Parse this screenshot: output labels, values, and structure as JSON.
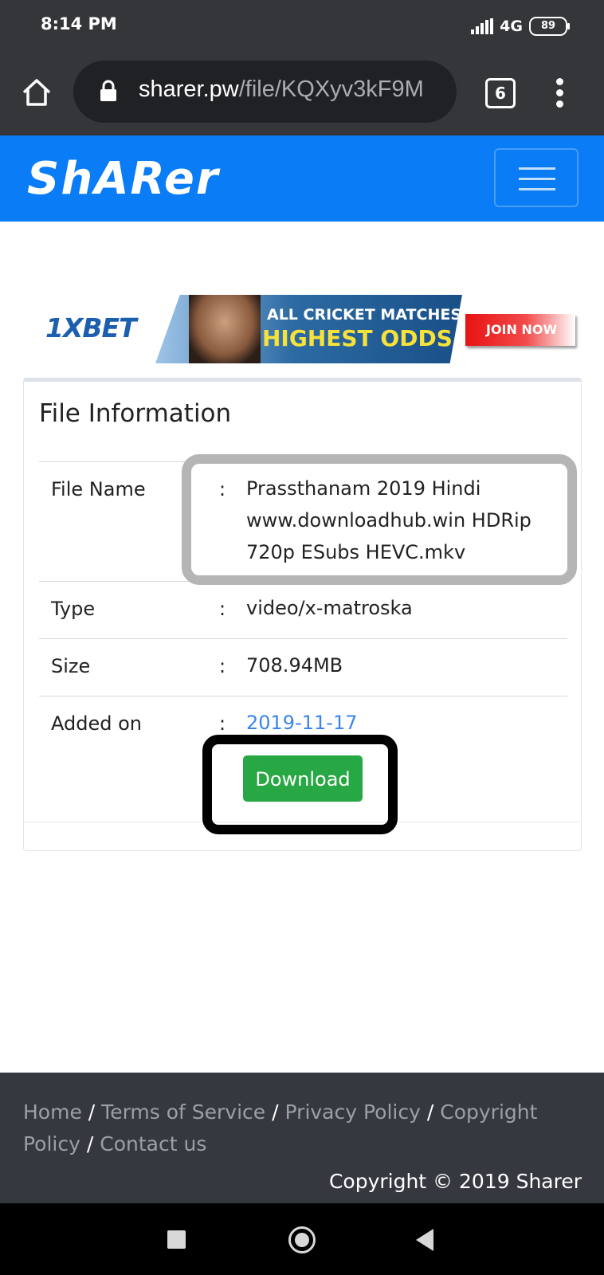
{
  "status_bar": {
    "time": "8:14 PM",
    "network": "4G",
    "battery": "89"
  },
  "browser": {
    "url_host": "sharer.pw",
    "url_path": "/file/KQXyv3kF9M",
    "tab_count": "6"
  },
  "site": {
    "logo_text": "ShARer"
  },
  "ad": {
    "brand": "1XBET",
    "line1": "ALL CRICKET MATCHES",
    "line2": "HIGHEST ODDS",
    "cta": "JOIN NOW"
  },
  "file_info": {
    "title": "File Information",
    "colon": ":",
    "rows": [
      {
        "label": "File Name",
        "value": "Prassthanam 2019 Hindi www.downloadhub.win HDRip 720p ESubs HEVC.mkv"
      },
      {
        "label": "Type",
        "value": "video/x-matroska"
      },
      {
        "label": "Size",
        "value": "708.94MB"
      },
      {
        "label": "Added on",
        "value": "2019-11-17"
      }
    ],
    "download_label": "Download"
  },
  "footer": {
    "links": [
      "Home",
      "Terms of Service",
      "Privacy Policy",
      "Copyright Policy",
      "Contact us"
    ],
    "separator": "/",
    "copyright": "Copyright © 2019 Sharer"
  },
  "colors": {
    "navbar": "#0a7cf5",
    "download_button": "#28a745",
    "link": "#3a86e8",
    "footer_bg": "#35393f",
    "browser_chrome": "#35363a"
  },
  "icons": {
    "home": "home-icon",
    "lock": "lock-icon",
    "menu": "more-vert-icon",
    "hamburger": "hamburger-icon"
  }
}
